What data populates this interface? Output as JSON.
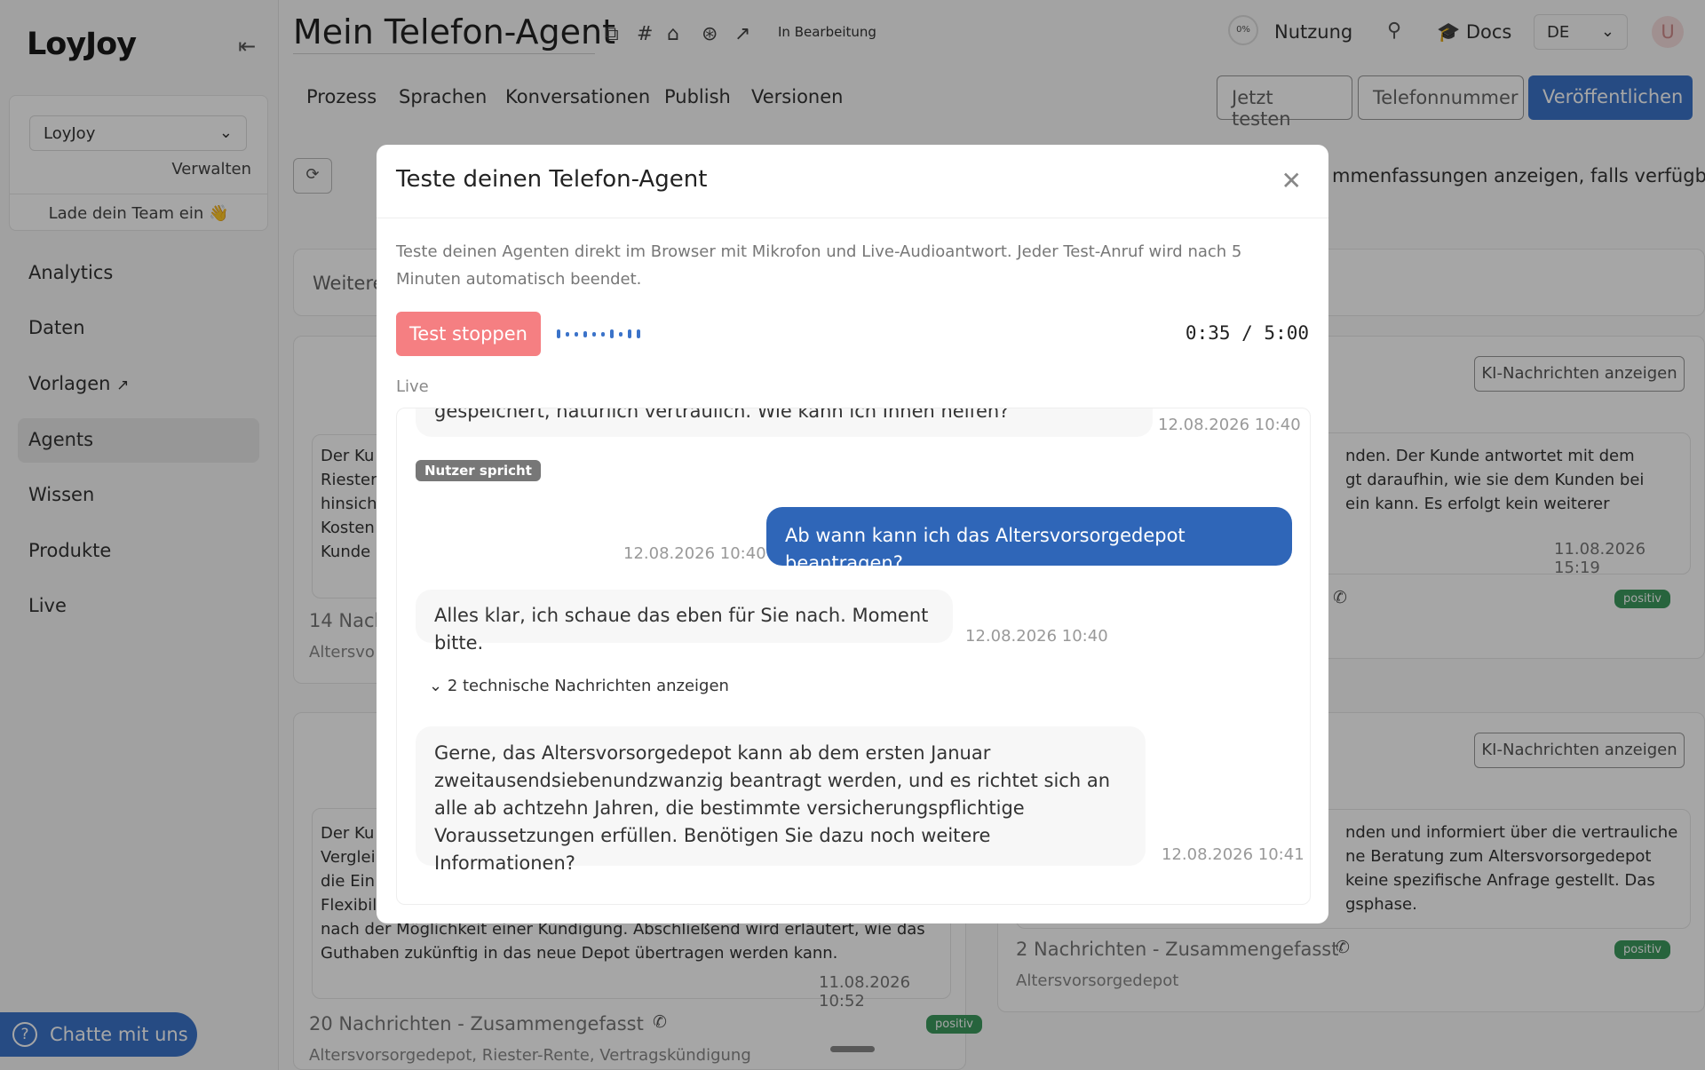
{
  "app": {
    "logo": "LoyJoy"
  },
  "sidebar": {
    "team_select": "LoyJoy",
    "manage": "Verwalten",
    "invite": "Lade dein Team ein 👋",
    "items": [
      {
        "label": "Analytics"
      },
      {
        "label": "Daten"
      },
      {
        "label": "Vorlagen"
      },
      {
        "label": "Agents",
        "active": true
      },
      {
        "label": "Wissen"
      },
      {
        "label": "Produkte"
      },
      {
        "label": "Live"
      }
    ],
    "chat_button": "Chatte mit uns"
  },
  "header": {
    "title": "Mein Telefon-Agent",
    "status": "In Bearbeitung",
    "usage_percent": "0%",
    "usage_label": "Nutzung",
    "docs": "Docs",
    "language": "DE",
    "avatar_initial": "U"
  },
  "tabs": [
    "Prozess",
    "Sprachen",
    "Konversationen",
    "Publish",
    "Versionen"
  ],
  "actions": {
    "test": "Jetzt testen",
    "phone": "Telefonnummer",
    "publish": "Veröffentlichen"
  },
  "filter_hint": "mmenfassungen anzeigen, falls verfügbar",
  "background": {
    "filter_label": "Weitere",
    "ki_button": "KI-Nachrichten anzeigen",
    "sentiment": "positiv",
    "card_left_1": {
      "lines": [
        "Der Ku",
        "Riester",
        "hinsich",
        "Kosten",
        "Kunde"
      ],
      "count": "14 Nach",
      "tags": "Altersvo"
    },
    "card_right_1": {
      "lines": [
        "nden. Der Kunde antwortet mit dem",
        "gt daraufhin, wie sie dem Kunden bei",
        "ein kann. Es erfolgt kein weiterer"
      ],
      "time": "11.08.2026 15:19"
    },
    "card_left_2": {
      "lines": [
        "Der Ku",
        "Verglei",
        "die Ein",
        "Flexibil",
        "nach der Möglichkeit einer Kündigung. Abschließend wird erläutert, wie das",
        "Guthaben zukünftig in das neue Depot übertragen werden kann."
      ],
      "time": "11.08.2026 10:52",
      "count": "20 Nachrichten - Zusammengefasst",
      "tags": "Altersvorsorgedepot, Riester-Rente, Vertragskündigung"
    },
    "card_right_2": {
      "lines": [
        "nden und informiert über die vertrauliche",
        "ne Beratung zum Altersvorsorgedepot",
        "keine spezifische Anfrage gestellt. Das",
        "gsphase."
      ],
      "count": "2 Nachrichten - Zusammengefasst",
      "tags": "Altersvorsorgedepot"
    }
  },
  "modal": {
    "title": "Teste deinen Telefon-Agent",
    "description": "Teste deinen Agenten direkt im Browser mit Mikrofon und Live-Audioantwort. Jeder Test-Anruf wird nach 5 Minuten automatisch beendet.",
    "stop_button": "Test stoppen",
    "timer": "0:35 / 5:00",
    "live_label": "Live",
    "messages": {
      "m0_text": "gespeichert, natürlich vertraulich. Wie kann ich Ihnen helfen?",
      "m0_time": "12.08.2026 10:40",
      "speaking_badge": "Nutzer spricht",
      "m1_text": "Ab wann kann ich das Altersvorsorgedepot beantragen?",
      "m1_time": "12.08.2026 10:40",
      "m2_text": "Alles klar, ich schaue das eben für Sie nach. Moment bitte.",
      "m2_time": "12.08.2026 10:40",
      "tech_toggle": "2 technische Nachrichten anzeigen",
      "m3_text": "Gerne, das Altersvorsorgedepot kann ab dem ersten Januar zweitausendsiebenundzwanzig beantragt werden, und es richtet sich an alle ab achtzehn Jahren, die bestimmte versicherungspflichtige Voraussetzungen erfüllen. Benötigen Sie dazu noch weitere Informationen?",
      "m3_time": "12.08.2026 10:41"
    }
  },
  "colors": {
    "primary": "#3b73c9",
    "stop": "#f57f82",
    "positive": "#3c9a5f"
  }
}
